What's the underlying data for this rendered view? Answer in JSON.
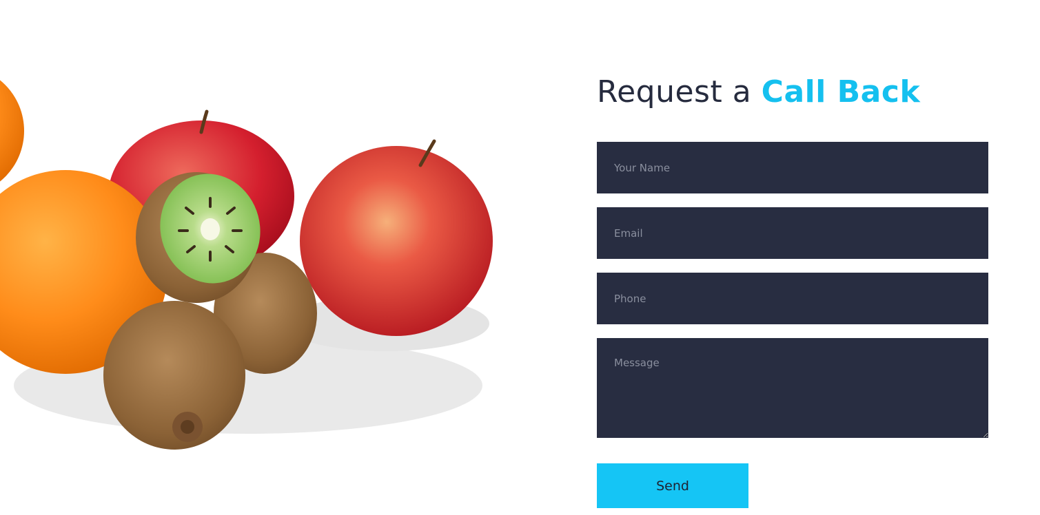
{
  "form": {
    "heading_plain": "Request a ",
    "heading_accent": "Call Back",
    "fields": {
      "name_placeholder": "Your Name",
      "email_placeholder": "Email",
      "phone_placeholder": "Phone",
      "message_placeholder": "Message"
    },
    "send_label": "Send"
  },
  "colors": {
    "accent": "#15c0ef",
    "field_background": "#282d41",
    "heading_text": "#262b3e",
    "button_background": "#15c5f5"
  },
  "image": {
    "subject": "fruit-group-oranges-apples-kiwis"
  }
}
